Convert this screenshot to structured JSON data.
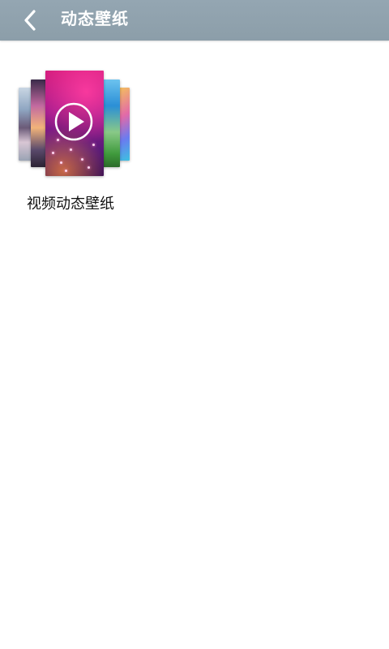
{
  "header": {
    "title": "动态壁纸",
    "back_icon": "chevron-left-icon",
    "background_color": "#8fa1ad"
  },
  "wallpapers": [
    {
      "label": "视频动态壁纸",
      "icon": "play-icon"
    }
  ]
}
